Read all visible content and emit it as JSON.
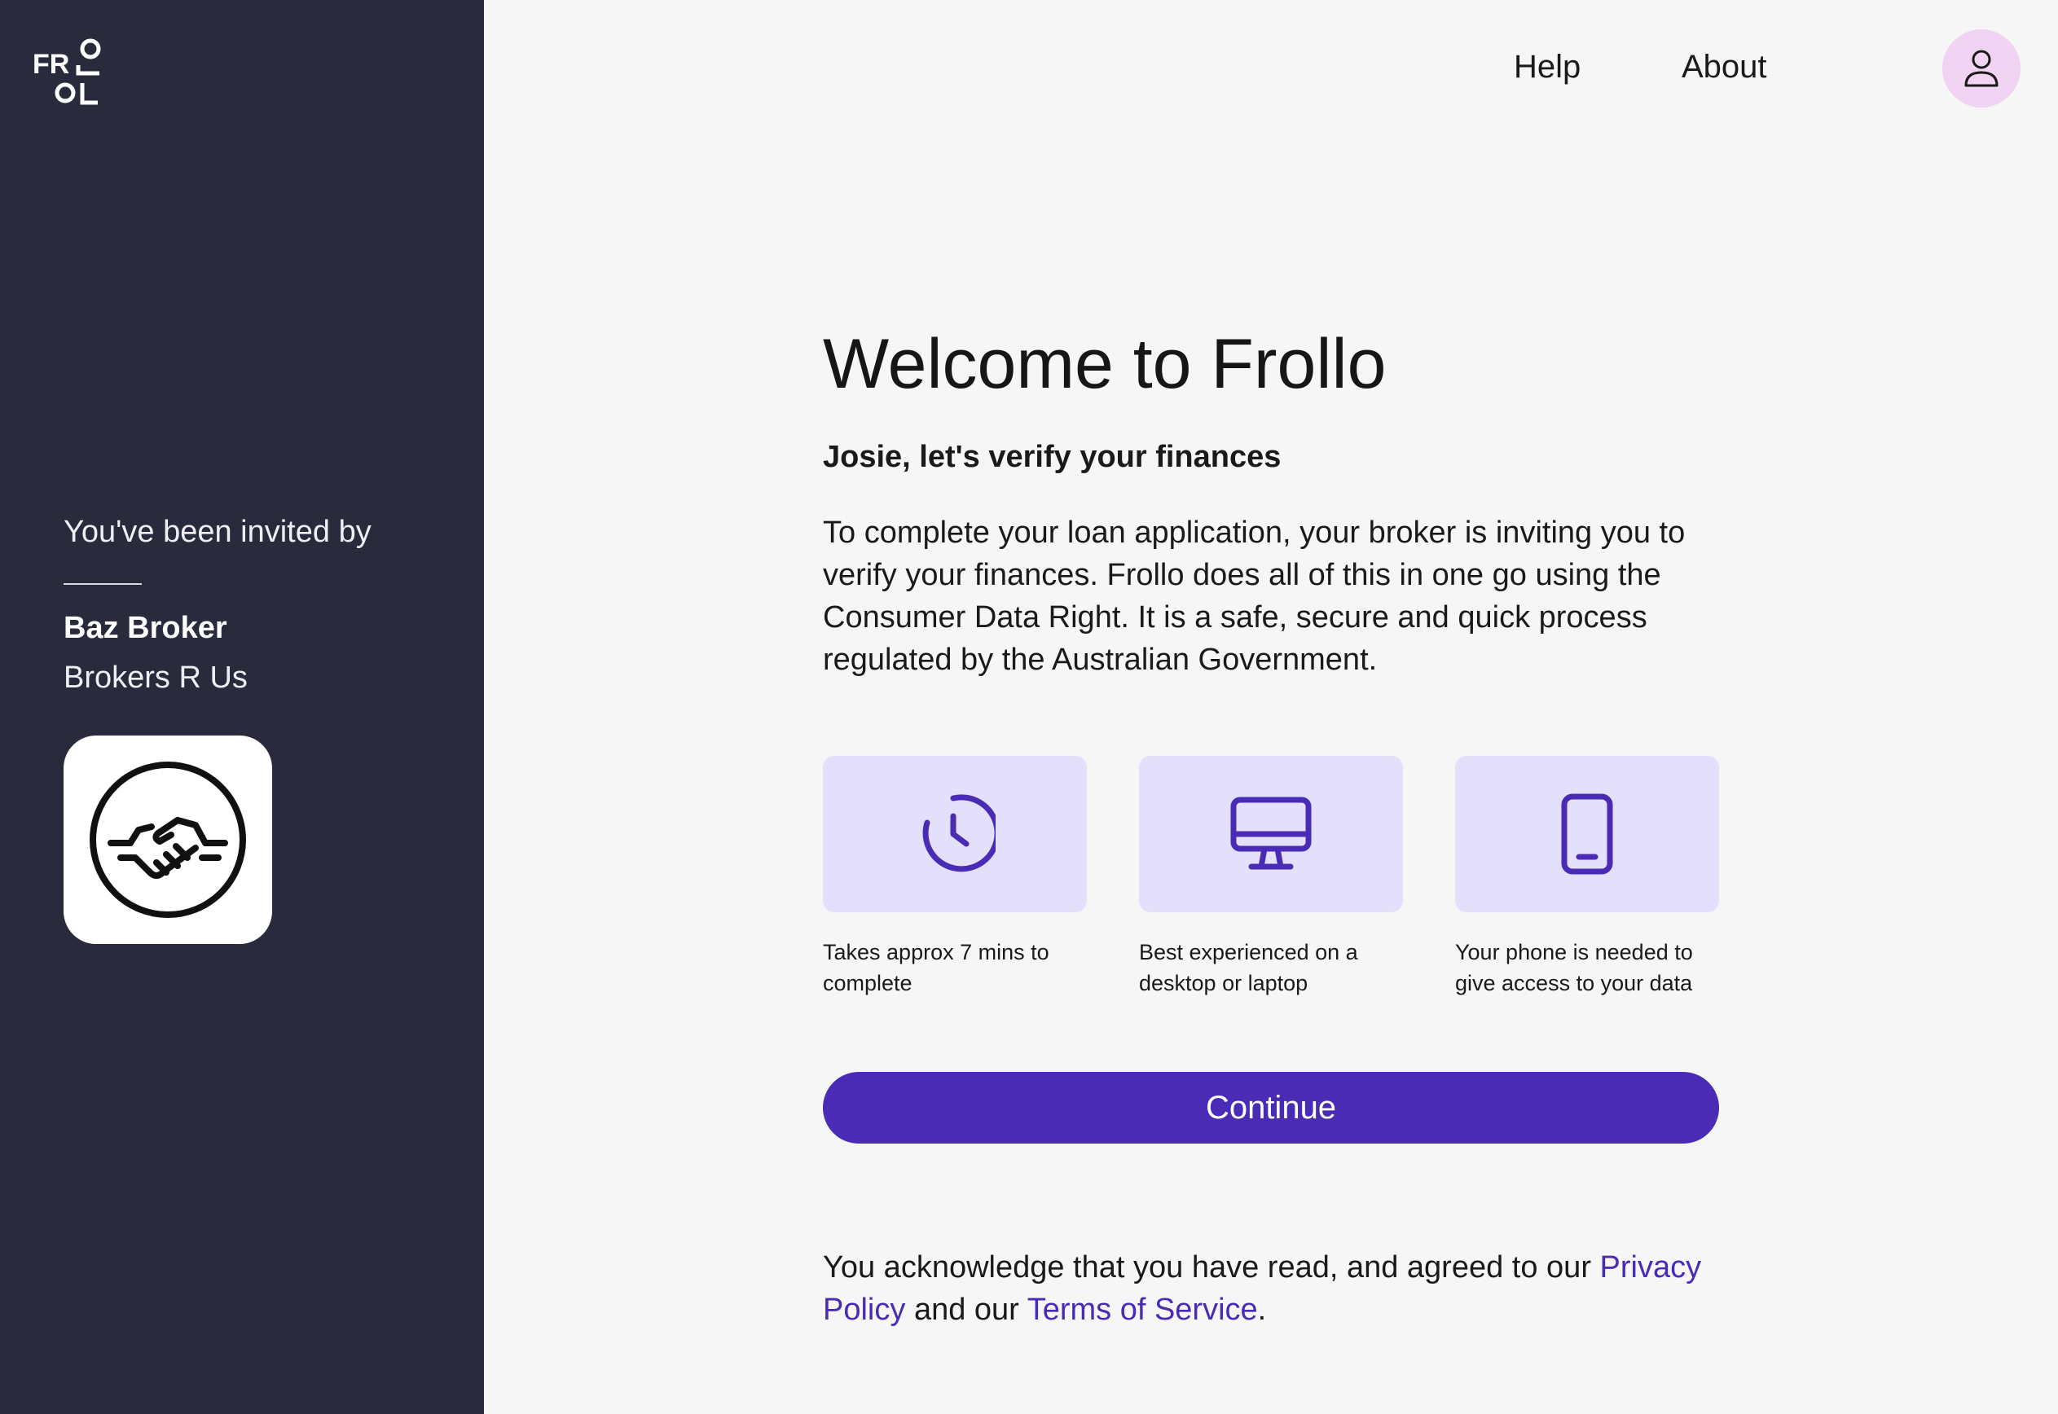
{
  "sidebar": {
    "logo_letters": "FROLLO",
    "invite_label": "You've been invited by",
    "broker_name": "Baz Broker",
    "broker_company": "Brokers R Us",
    "broker_logo_icon": "handshake-icon"
  },
  "nav": {
    "help": "Help",
    "about": "About",
    "profile_icon": "user-icon"
  },
  "main": {
    "title": "Welcome to Frollo",
    "subtitle": "Josie, let's verify your finances",
    "intro": "To complete your loan application, your broker is inviting you to verify your finances. Frollo does all of this in one go using the Consumer Data Right. It is a safe, secure and quick process regulated by the Australian Government.",
    "features": [
      {
        "icon": "clock-icon",
        "caption": "Takes approx 7 mins to complete"
      },
      {
        "icon": "desktop-icon",
        "caption": "Best experienced on a desktop or laptop"
      },
      {
        "icon": "phone-icon",
        "caption": "Your phone is needed to give access to your data"
      }
    ],
    "continue_label": "Continue",
    "legal": {
      "prefix": "You acknowledge that you have read, and agreed to our",
      "privacy_link": "Privacy Policy",
      "middle": "and our",
      "terms_link": "Terms of Service",
      "suffix": "."
    }
  },
  "colors": {
    "sidebar_bg": "#292a3c",
    "page_bg": "#f6f6f6",
    "accent": "#4a2bb6",
    "card_bg": "#e4e0fb",
    "avatar_bg": "#f1d4f3"
  }
}
